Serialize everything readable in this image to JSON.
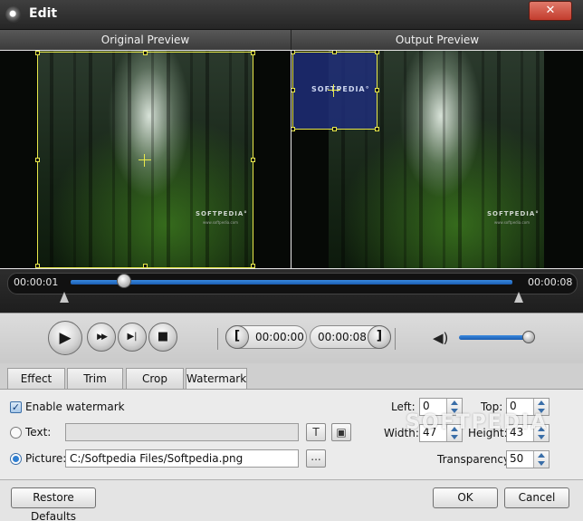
{
  "window": {
    "title": "Edit",
    "close_label": "✕"
  },
  "preview": {
    "original_label": "Original Preview",
    "output_label": "Output Preview",
    "brand_text": "SOFTPEDIA°",
    "brand_url": "www.softpedia.com",
    "watermark_text": "SOFTPEDIA°"
  },
  "timeline": {
    "start_time": "00:00:01",
    "end_time": "00:00:08",
    "position": 0.12
  },
  "controls": {
    "play_icon": "▶",
    "forward_icon": "▶▶",
    "next_frame_icon": "▶|",
    "stop_icon": "■",
    "start_bracket": "[",
    "end_bracket": "]",
    "start_time": "00:00:00",
    "end_time": "00:00:08",
    "volume_icon": "◀)",
    "volume_level": 1.0
  },
  "tabs": [
    {
      "label": "Effect",
      "active": false
    },
    {
      "label": "Trim",
      "active": false
    },
    {
      "label": "Crop",
      "active": false
    },
    {
      "label": "Watermark",
      "active": true
    }
  ],
  "watermark": {
    "enable_label": "Enable watermark",
    "enabled": true,
    "text_label": "Text:",
    "text_value": "",
    "text_font_icon": "T",
    "text_color_icon": "▣",
    "picture_label": "Picture:",
    "picture_path": "C:/Softpedia Files/Softpedia.png",
    "browse_label": "...",
    "mode": "picture",
    "left_label": "Left:",
    "left_value": "0",
    "top_label": "Top:",
    "top_value": "0",
    "width_label": "Width:",
    "width_value": "47",
    "height_label": "Height:",
    "height_value": "43",
    "transparency_label": "Transparency:",
    "transparency_value": "50"
  },
  "overlay_watermark": "SOFTPEDIA",
  "footer": {
    "restore_label": "Restore Defaults",
    "ok_label": "OK",
    "cancel_label": "Cancel"
  }
}
